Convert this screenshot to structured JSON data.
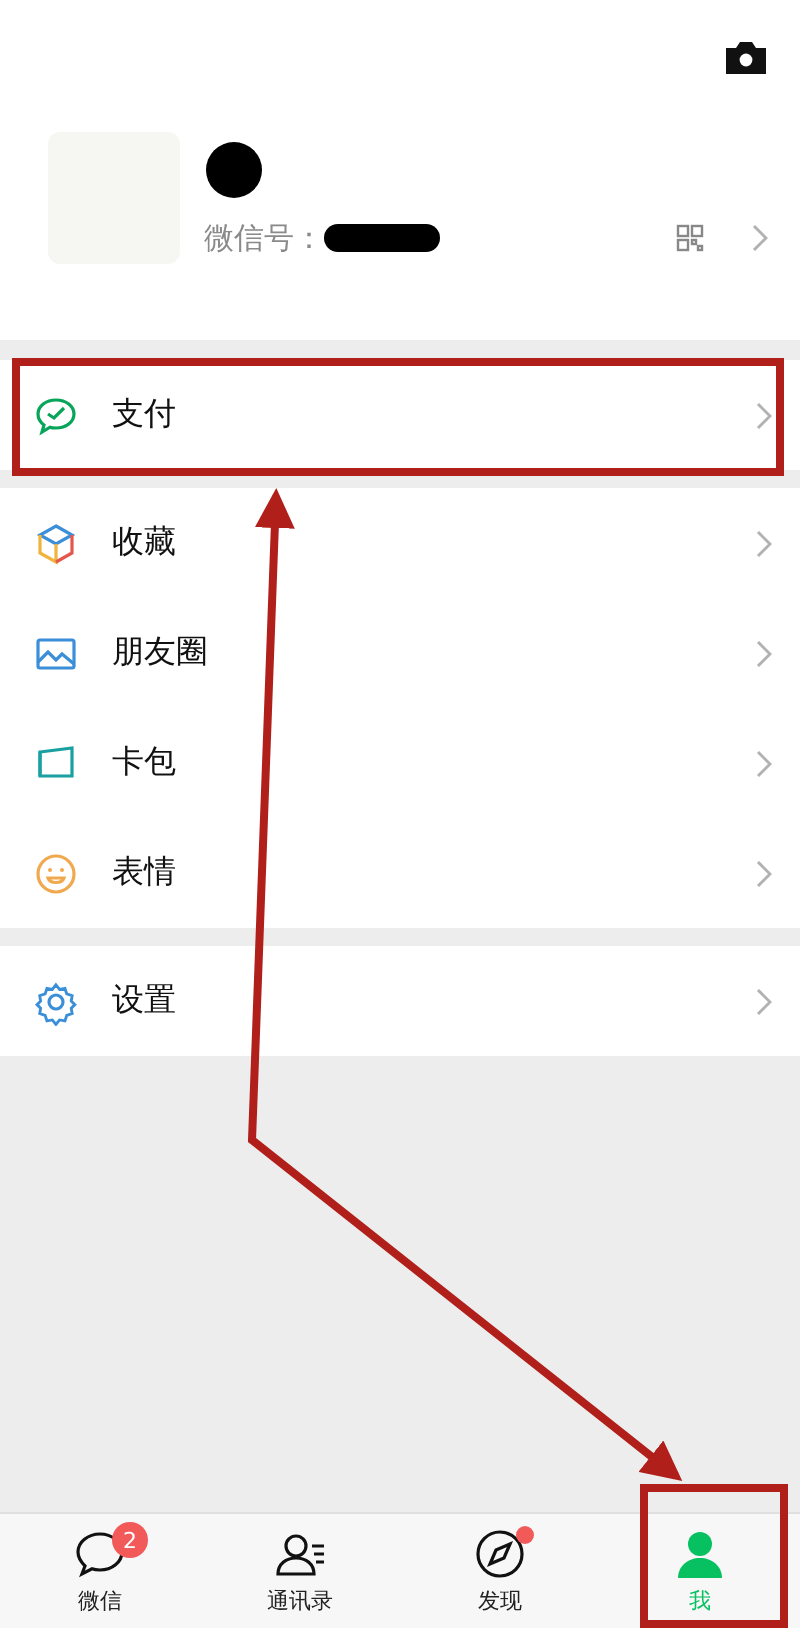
{
  "profile": {
    "id_label": "微信号："
  },
  "menu_groups": [
    {
      "items": [
        {
          "label": "支付",
          "highlighted": true
        }
      ]
    },
    {
      "items": [
        {
          "label": "收藏",
          "highlighted": false
        },
        {
          "label": "朋友圈",
          "highlighted": false
        },
        {
          "label": "卡包",
          "highlighted": false
        },
        {
          "label": "表情",
          "highlighted": false
        }
      ]
    },
    {
      "items": [
        {
          "label": "设置",
          "highlighted": false
        }
      ]
    }
  ],
  "tabs": [
    {
      "label": "微信",
      "badge": "2",
      "dot": false,
      "selected": false,
      "highlighted": false
    },
    {
      "label": "通讯录",
      "dot": false,
      "selected": false,
      "highlighted": false
    },
    {
      "label": "发现",
      "dot": true,
      "selected": false,
      "highlighted": false
    },
    {
      "label": "我",
      "dot": false,
      "selected": true,
      "highlighted": true
    }
  ]
}
